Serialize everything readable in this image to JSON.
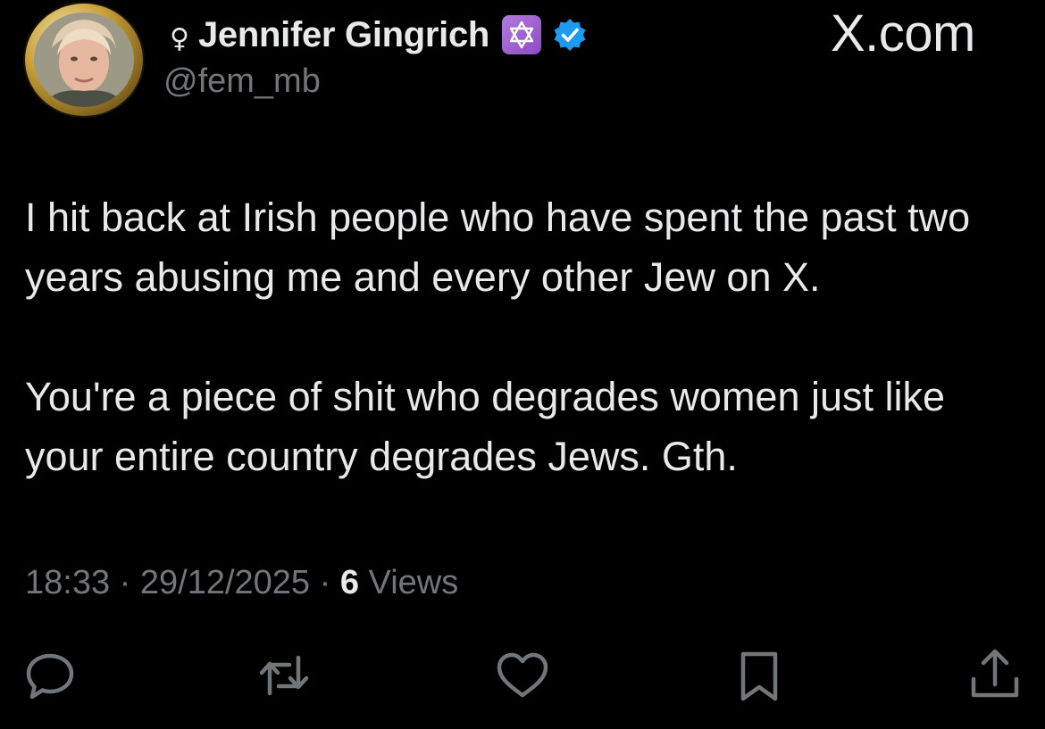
{
  "site_mark": "X.com",
  "author": {
    "gender_symbol": "♀",
    "display_name": "Jennifer Gingrich",
    "handle": "@fem_mb",
    "badges": [
      "star-of-david-icon",
      "verified-check-icon"
    ]
  },
  "tweet": {
    "paragraphs": [
      "I hit back at Irish people who have spent the past two years abusing me and every other Jew on X.",
      "You're a piece of shit who degrades women just like your entire country degrades Jews. Gth."
    ],
    "time": "18:33",
    "separator": " · ",
    "date": "29/12/2025",
    "views_count": "6",
    "views_label": "Views"
  },
  "actions": [
    "reply-icon",
    "retweet-icon",
    "like-icon",
    "bookmark-icon",
    "share-icon"
  ],
  "colors": {
    "background": "#000000",
    "text": "#e7e9ea",
    "secondary": "#71767b",
    "verified": "#1d9bf0",
    "star_badge": "#9b5fd1"
  }
}
